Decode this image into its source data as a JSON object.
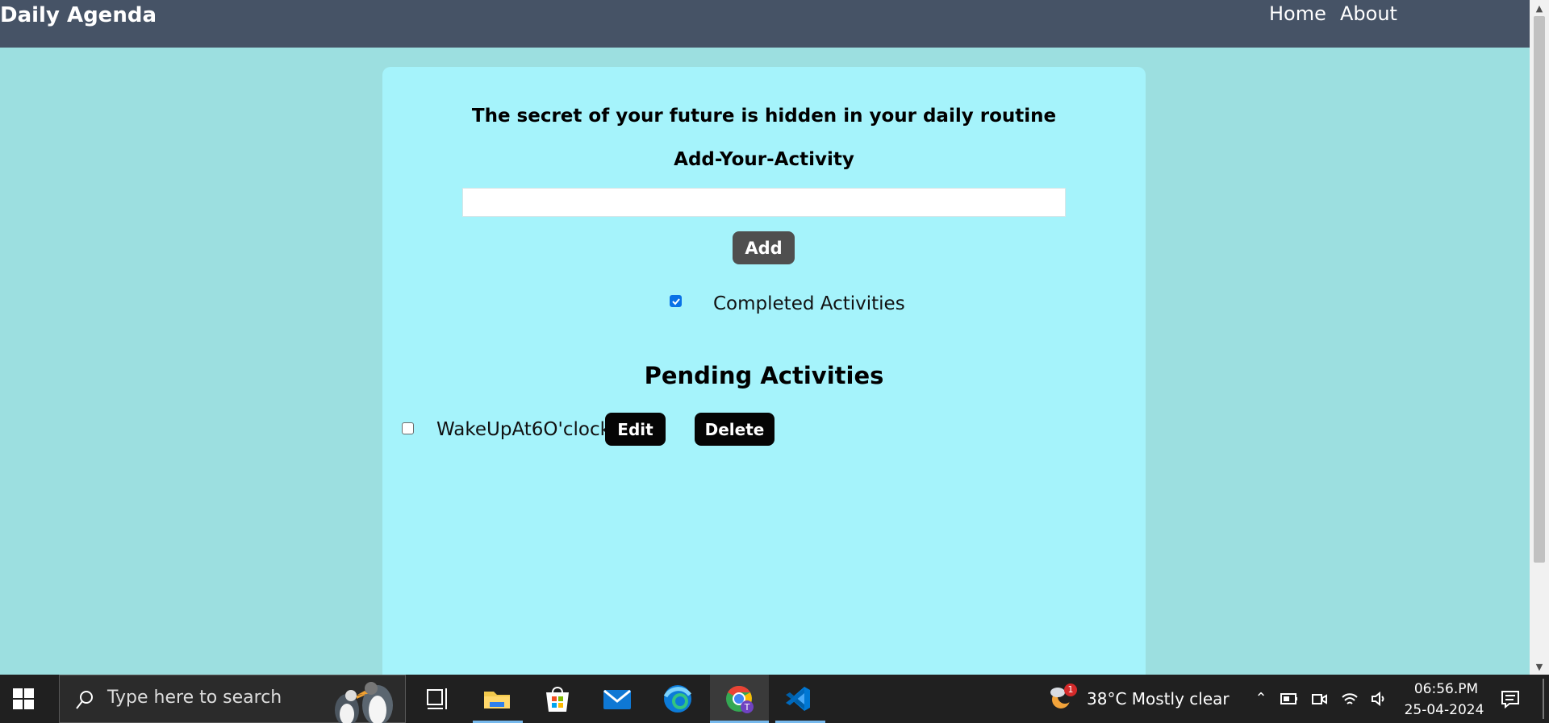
{
  "navbar": {
    "brand": "Daily Agenda",
    "links": [
      "Home",
      "About"
    ],
    "background": "#465366"
  },
  "card": {
    "quote": "The secret of your future is hidden in your daily routine",
    "add_title": "Add-Your-Activity",
    "input_value": "",
    "add_button": "Add",
    "completed_checkbox_checked": true,
    "completed_label": "Completed Activities",
    "pending_title": "Pending Activities",
    "tasks": [
      {
        "checked": false,
        "text": "WakeUpAt6O'clock",
        "edit": "Edit",
        "delete": "Delete"
      }
    ],
    "background": "#a5f3fb"
  },
  "page_background": "#9cdfe0",
  "taskbar": {
    "search_placeholder": "Type here to search",
    "apps": [
      "task-view-icon",
      "file-explorer-icon",
      "microsoft-store-icon",
      "mail-icon",
      "edge-icon",
      "chrome-icon",
      "vscode-icon"
    ],
    "weather_badge": "1",
    "weather": "38°C  Mostly clear",
    "time": "06:56.PM",
    "date": "25-04-2024"
  }
}
